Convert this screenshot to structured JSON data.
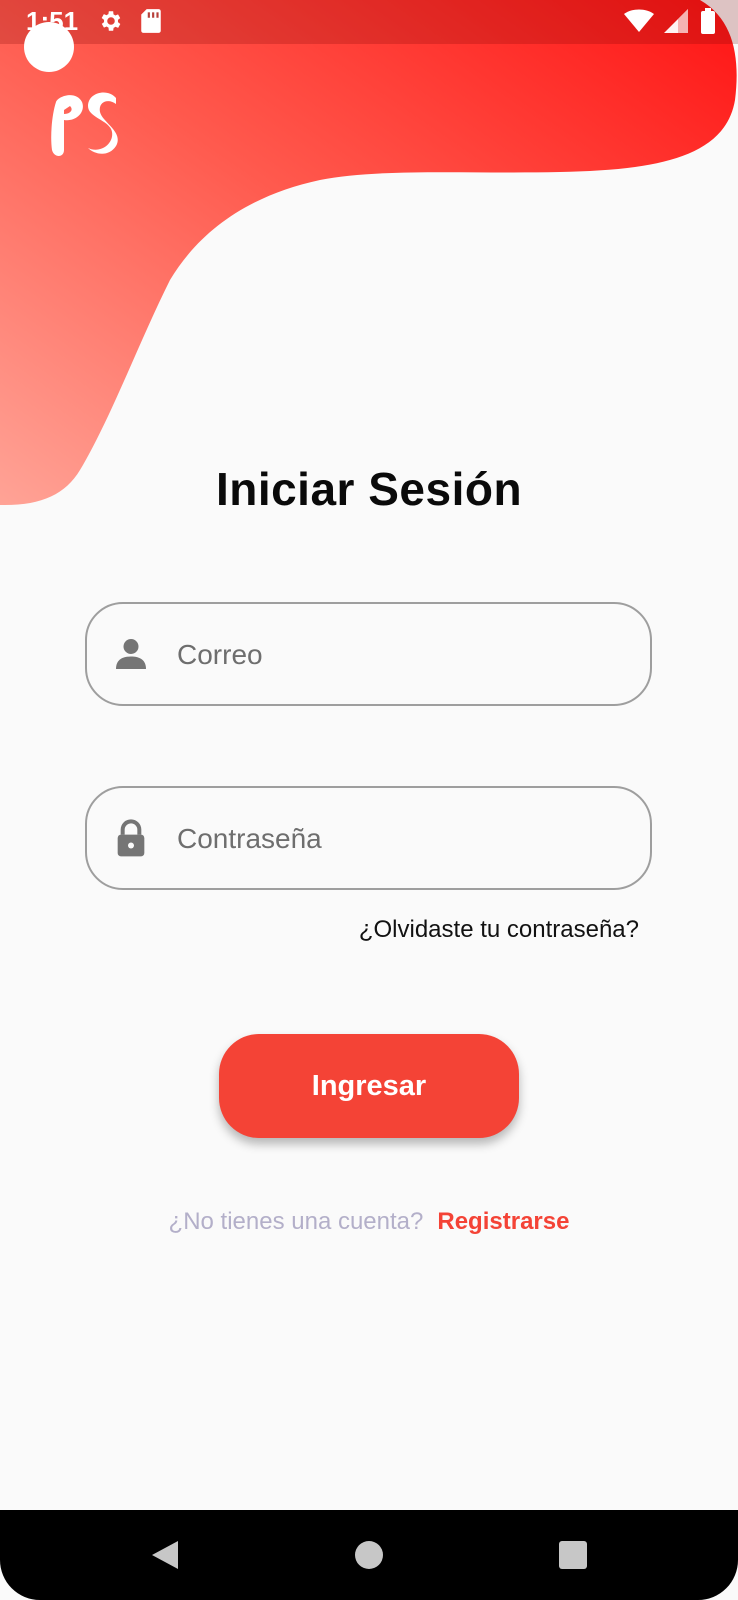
{
  "status_bar": {
    "time": "1:51",
    "left_icons": [
      "gear-icon",
      "sd-card-icon"
    ],
    "right_icons": [
      "wifi-icon",
      "signal-icon",
      "battery-icon"
    ]
  },
  "header": {
    "logo_text": "PS",
    "gradient_start": "#ff9f8f",
    "gradient_end": "#ff1a1a"
  },
  "login": {
    "title": "Iniciar Sesión",
    "email_placeholder": "Correo",
    "email_icon": "person-icon",
    "password_placeholder": "Contraseña",
    "password_icon": "lock-icon",
    "forgot_password": "¿Olvidaste tu contraseña?",
    "submit_label": "Ingresar",
    "no_account": "¿No tienes una cuenta?",
    "register_link": "Registrarse"
  },
  "colors": {
    "accent": "#f44336",
    "muted_text": "#b3afc9",
    "field_border": "#9e9e9e",
    "icon_gray": "#757575"
  },
  "nav_bar": {
    "buttons": [
      "back-icon",
      "home-icon",
      "recents-icon"
    ]
  }
}
